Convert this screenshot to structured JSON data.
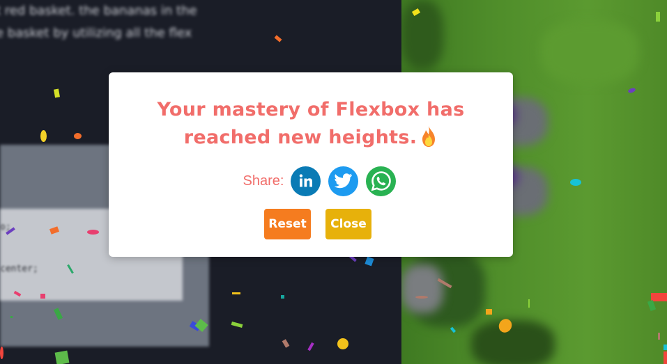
{
  "background": {
    "text_lines": [
      "t red basket. the bananas in the",
      "e basket by utilizing all the flex"
    ],
    "panel_lines": [
      "o;",
      "",
      "center;"
    ]
  },
  "modal": {
    "title_line1": "Your mastery of Flexbox has",
    "title_line2": "reached new heights.",
    "title_icon": "fire-icon",
    "share_label": "Share:",
    "social": [
      {
        "name": "linkedin",
        "icon": "linkedin-icon",
        "color": "#0a7bb5"
      },
      {
        "name": "twitter",
        "icon": "twitter-icon",
        "color": "#1d9bf0"
      },
      {
        "name": "whatsapp",
        "icon": "whatsapp-icon",
        "color": "#29b252"
      }
    ],
    "reset_label": "Reset",
    "close_label": "Close"
  },
  "colors": {
    "title": "#f16d6a",
    "reset_button": "#f57c1f",
    "close_button": "#e7b10b",
    "modal_bg": "#ffffff"
  }
}
